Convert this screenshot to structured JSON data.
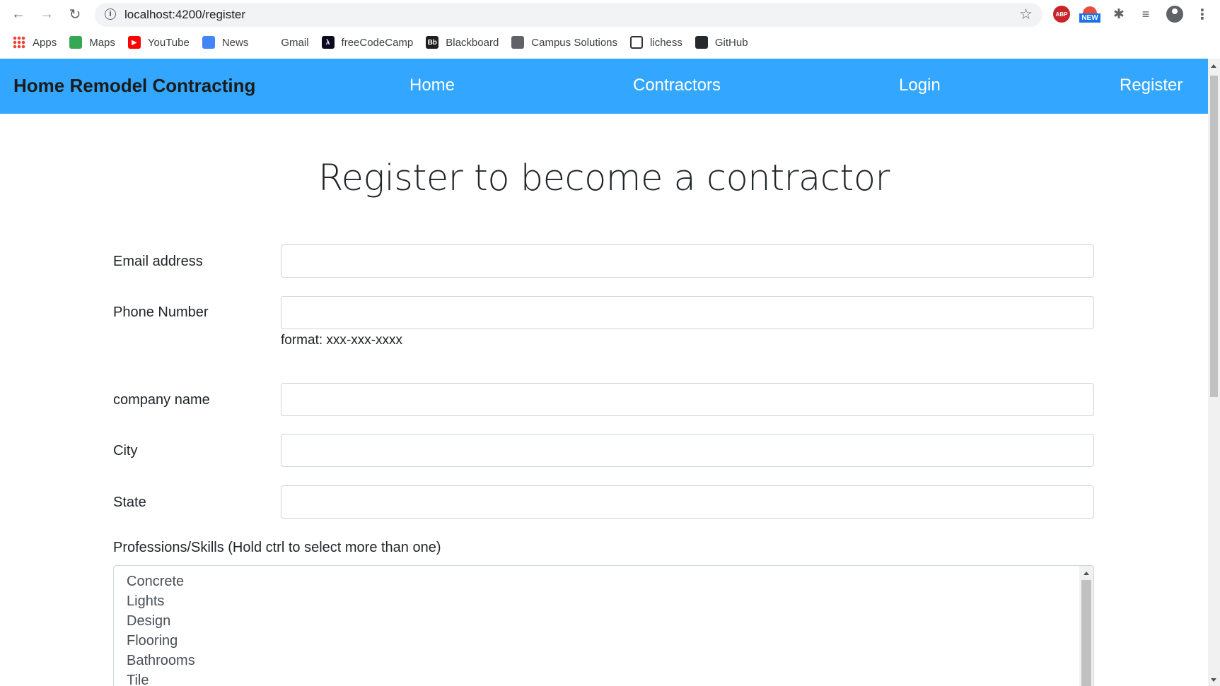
{
  "browser": {
    "url": "localhost:4200/register",
    "bookmarks": [
      {
        "label": "Apps",
        "icon": "apps-grid-icon"
      },
      {
        "label": "Maps",
        "icon": "maps-icon"
      },
      {
        "label": "YouTube",
        "icon": "youtube-icon"
      },
      {
        "label": "News",
        "icon": "news-icon"
      },
      {
        "label": "Gmail",
        "icon": "gmail-icon"
      },
      {
        "label": "freeCodeCamp",
        "icon": "freecodecamp-icon"
      },
      {
        "label": "Blackboard",
        "icon": "blackboard-icon"
      },
      {
        "label": "Campus Solutions",
        "icon": "globe-icon"
      },
      {
        "label": "lichess",
        "icon": "lichess-icon"
      },
      {
        "label": "GitHub",
        "icon": "github-icon"
      }
    ],
    "extensions": {
      "abp_label": "ABP",
      "new_label": "NEW"
    }
  },
  "navbar": {
    "brand": "Home Remodel Contracting",
    "links": [
      "Home",
      "Contractors",
      "Login",
      "Register"
    ],
    "background": "#33a7ff"
  },
  "form": {
    "title": "Register to become a contractor",
    "email_label": "Email address",
    "email_value": "",
    "phone_label": "Phone Number",
    "phone_value": "",
    "phone_hint": "format: xxx-xxx-xxxx",
    "company_label": "company name",
    "company_value": "",
    "city_label": "City",
    "city_value": "",
    "state_label": "State",
    "state_value": "",
    "skills_label": "Professions/Skills (Hold ctrl to select more than one)",
    "skills_options": [
      "Concrete",
      "Lights",
      "Design",
      "Flooring",
      "Bathrooms",
      "Tile"
    ]
  }
}
